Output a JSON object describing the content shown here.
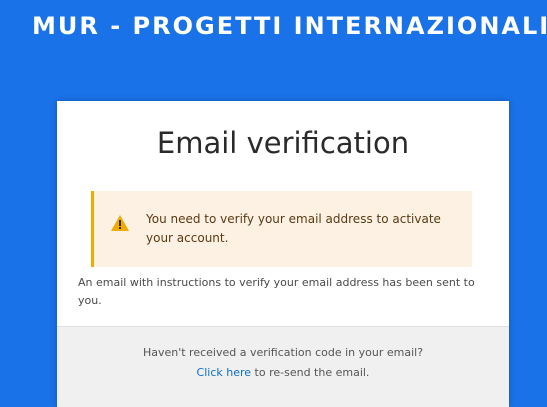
{
  "header": {
    "app_title": "MUR - PROGETTI INTERNAZIONALI"
  },
  "card": {
    "title": "Email verification",
    "alert": {
      "icon": "warning-icon",
      "message": "You need to verify your email address to activate your account."
    },
    "info_message": "An email with instructions to verify your email address has been sent to you.",
    "footer": {
      "question": "Haven't received a verification code in your email?",
      "resend_link_label": "Click here",
      "resend_suffix": " to re-send the email."
    }
  },
  "colors": {
    "page_background": "#1a72e8",
    "alert_background": "#fdf1e3",
    "alert_accent": "#f0ab00",
    "link": "#0b6fcc"
  }
}
